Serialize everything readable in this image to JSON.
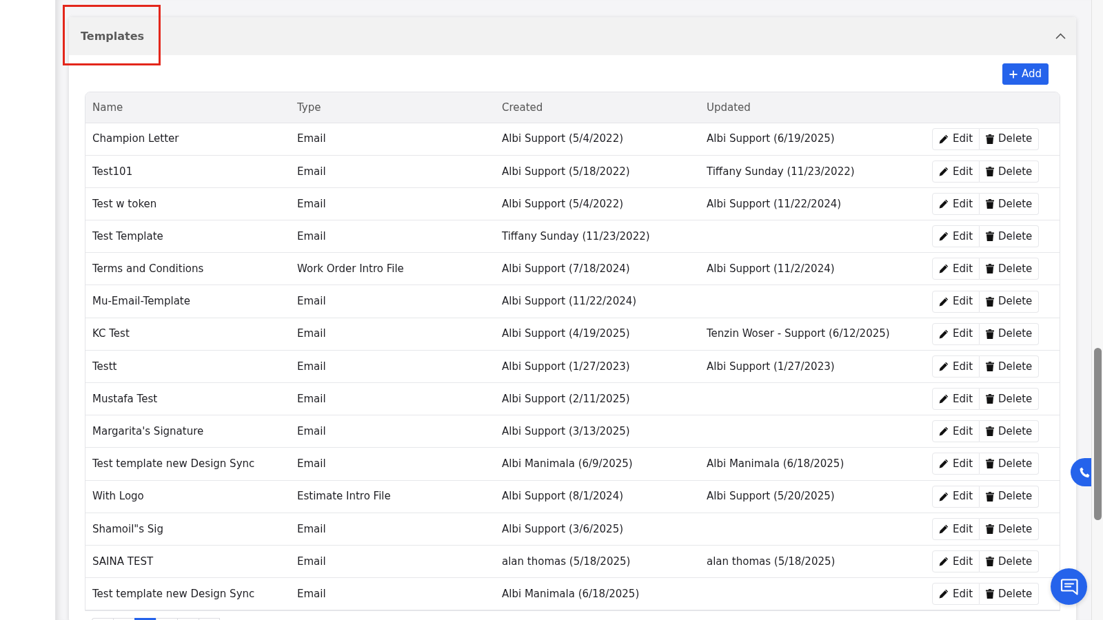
{
  "panel": {
    "title": "Templates",
    "title_highlighted": true,
    "expanded": true,
    "add_button": {
      "label": "Add"
    }
  },
  "table": {
    "columns": [
      "Name",
      "Type",
      "Created",
      "Updated"
    ],
    "rows": [
      {
        "name": "Champion Letter",
        "type": "Email",
        "created": "Albi Support (5/4/2022)",
        "updated": "Albi Support (6/19/2025)",
        "actions": [
          {
            "kind": "edit",
            "label": "Edit"
          },
          {
            "kind": "delete",
            "label": "Delete"
          }
        ]
      },
      {
        "name": "Test101",
        "type": "Email",
        "created": "Albi Support (5/18/2022)",
        "updated": "Tiffany Sunday (11/23/2022)",
        "actions": [
          {
            "kind": "edit",
            "label": "Edit"
          },
          {
            "kind": "delete",
            "label": "Delete"
          }
        ]
      },
      {
        "name": "Test w token",
        "type": "Email",
        "created": "Albi Support (5/4/2022)",
        "updated": "Albi Support (11/22/2024)",
        "actions": [
          {
            "kind": "edit",
            "label": "Edit"
          },
          {
            "kind": "delete",
            "label": "Delete"
          }
        ]
      },
      {
        "name": "Test Template",
        "type": "Email",
        "created": "Tiffany Sunday (11/23/2022)",
        "actions": [
          {
            "kind": "edit",
            "label": "Edit"
          },
          {
            "kind": "delete",
            "label": "Delete"
          }
        ]
      },
      {
        "name": "Terms and Conditions",
        "type": "Work Order Intro File",
        "created": "Albi Support (7/18/2024)",
        "updated": "Albi Support (11/2/2024)",
        "actions": [
          {
            "kind": "edit",
            "label": "Edit"
          },
          {
            "kind": "delete",
            "label": "Delete"
          }
        ]
      },
      {
        "name": "Mu-Email-Template",
        "type": "Email",
        "created": "Albi Support (11/22/2024)",
        "actions": [
          {
            "kind": "edit",
            "label": "Edit"
          },
          {
            "kind": "delete",
            "label": "Delete"
          }
        ]
      },
      {
        "name": "KC Test",
        "type": "Email",
        "created": "Albi Support (4/19/2025)",
        "updated": "Tenzin Woser - Support (6/12/2025)",
        "actions": [
          {
            "kind": "edit",
            "label": "Edit"
          },
          {
            "kind": "delete",
            "label": "Delete"
          }
        ]
      },
      {
        "name": "Testt",
        "type": "Email",
        "created": "Albi Support (1/27/2023)",
        "updated": "Albi Support (1/27/2023)",
        "actions": [
          {
            "kind": "edit",
            "label": "Edit"
          },
          {
            "kind": "delete",
            "label": "Delete"
          }
        ]
      },
      {
        "name": "Mustafa Test",
        "type": "Email",
        "created": "Albi Support (2/11/2025)",
        "actions": [
          {
            "kind": "edit",
            "label": "Edit"
          },
          {
            "kind": "delete",
            "label": "Delete"
          }
        ]
      },
      {
        "name": "Margarita's Signature",
        "type": "Email",
        "created": "Albi Support (3/13/2025)",
        "actions": [
          {
            "kind": "edit",
            "label": "Edit"
          },
          {
            "kind": "delete",
            "label": "Delete"
          }
        ]
      },
      {
        "name": "Test template new Design Sync",
        "type": "Email",
        "created": "Albi Manimala (6/9/2025)",
        "updated": "Albi Manimala (6/18/2025)",
        "actions": [
          {
            "kind": "edit",
            "label": "Edit"
          },
          {
            "kind": "delete",
            "label": "Delete"
          }
        ]
      },
      {
        "name": "With Logo",
        "type": "Estimate Intro File",
        "created": "Albi Support (8/1/2024)",
        "updated": "Albi Support (5/20/2025)",
        "actions": [
          {
            "kind": "edit",
            "label": "Edit"
          },
          {
            "kind": "delete",
            "label": "Delete"
          }
        ]
      },
      {
        "name": "Shamoil\"s Sig",
        "type": "Email",
        "created": "Albi Support (3/6/2025)",
        "actions": [
          {
            "kind": "edit",
            "label": "Edit"
          },
          {
            "kind": "delete",
            "label": "Delete"
          }
        ]
      },
      {
        "name": "SAINA TEST",
        "type": "Email",
        "created": "alan thomas (5/18/2025)",
        "updated": "alan thomas (5/18/2025)",
        "actions": [
          {
            "kind": "edit",
            "label": "Edit"
          },
          {
            "kind": "delete",
            "label": "Delete"
          }
        ]
      },
      {
        "name": "Test template new Design Sync",
        "type": "Email",
        "created": "Albi Manimala (6/18/2025)",
        "actions": [
          {
            "kind": "edit",
            "label": "Edit"
          },
          {
            "kind": "delete",
            "label": "Delete"
          }
        ]
      }
    ]
  },
  "pagination": [
    {
      "selected": false
    },
    {
      "selected": false
    },
    {
      "selected": true
    },
    {
      "selected": false
    },
    {
      "selected": false
    },
    {
      "selected": false
    }
  ]
}
